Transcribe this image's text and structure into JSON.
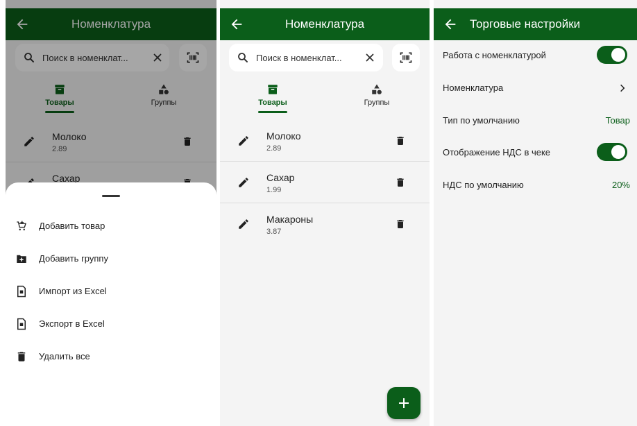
{
  "colors": {
    "primary": "#0b5e1a",
    "background": "#f4f4f4",
    "surface": "#ffffff"
  },
  "nomenclature": {
    "title": "Номенклатура",
    "search_placeholder": "Поиск в номенклат...",
    "tabs": [
      {
        "label": "Товары",
        "icon": "archive-box-icon",
        "active": true
      },
      {
        "label": "Группы",
        "icon": "shapes-icon",
        "active": false
      }
    ],
    "items": [
      {
        "name": "Молоко",
        "price": "2.89"
      },
      {
        "name": "Сахар",
        "price": "1.99"
      },
      {
        "name": "Макароны",
        "price": "3.87"
      }
    ]
  },
  "menu": {
    "items": [
      {
        "label": "Добавить товар",
        "icon": "cart-add-icon"
      },
      {
        "label": "Добавить группу",
        "icon": "folder-add-icon"
      },
      {
        "label": "Импорт из Excel",
        "icon": "excel-import-icon"
      },
      {
        "label": "Экспорт в Excel",
        "icon": "excel-export-icon"
      },
      {
        "label": "Удалить все",
        "icon": "trash-icon"
      }
    ]
  },
  "settings": {
    "title": "Торговые настройки",
    "rows": [
      {
        "label": "Работа с номенклатурой",
        "kind": "toggle",
        "on": true
      },
      {
        "label": "Номенклатура",
        "kind": "chevron"
      },
      {
        "label": "Тип по умолчанию",
        "kind": "value",
        "value": "Товар"
      },
      {
        "label": "Отображение НДС в чеке",
        "kind": "toggle",
        "on": true
      },
      {
        "label": "НДС по умолчанию",
        "kind": "value",
        "value": "20%"
      }
    ]
  }
}
